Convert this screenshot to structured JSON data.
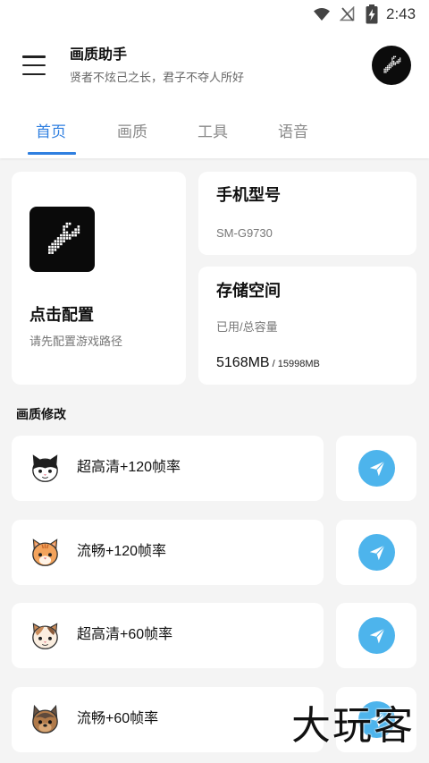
{
  "status_bar": {
    "time": "2:43",
    "icons": [
      "wifi-icon",
      "no-signal-icon",
      "battery-charging-icon"
    ]
  },
  "header": {
    "title": "画质助手",
    "subtitle": "贤者不炫己之长，君子不夺人所好",
    "menu_icon": "menu-icon",
    "avatar_icon": "wrench-icon"
  },
  "tabs": [
    {
      "label": "首页",
      "active": true
    },
    {
      "label": "画质",
      "active": false
    },
    {
      "label": "工具",
      "active": false
    },
    {
      "label": "语音",
      "active": false
    }
  ],
  "config_card": {
    "title": "点击配置",
    "subtitle": "请先配置游戏路径",
    "icon": "wrench-icon"
  },
  "device_card": {
    "title": "手机型号",
    "value": "SM-G9730"
  },
  "storage_card": {
    "title": "存储空间",
    "label": "已用/总容量",
    "used": "5168MB",
    "total": " / 15998MB"
  },
  "section": {
    "title": "画质修改"
  },
  "presets": [
    {
      "label": "超高清+120帧率",
      "icon": "black-white-cat-icon",
      "action_icon": "send-icon"
    },
    {
      "label": "流畅+120帧率",
      "icon": "orange-cat-icon",
      "action_icon": "send-icon"
    },
    {
      "label": "超高清+60帧率",
      "icon": "calico-cat-icon",
      "action_icon": "send-icon"
    },
    {
      "label": "流畅+60帧率",
      "icon": "brown-dog-icon",
      "action_icon": "send-icon"
    }
  ],
  "watermark": {
    "text": "大玩客"
  },
  "colors": {
    "accent": "#2f7fe0",
    "plane": "#4db4ec",
    "background": "#f4f4f4"
  }
}
